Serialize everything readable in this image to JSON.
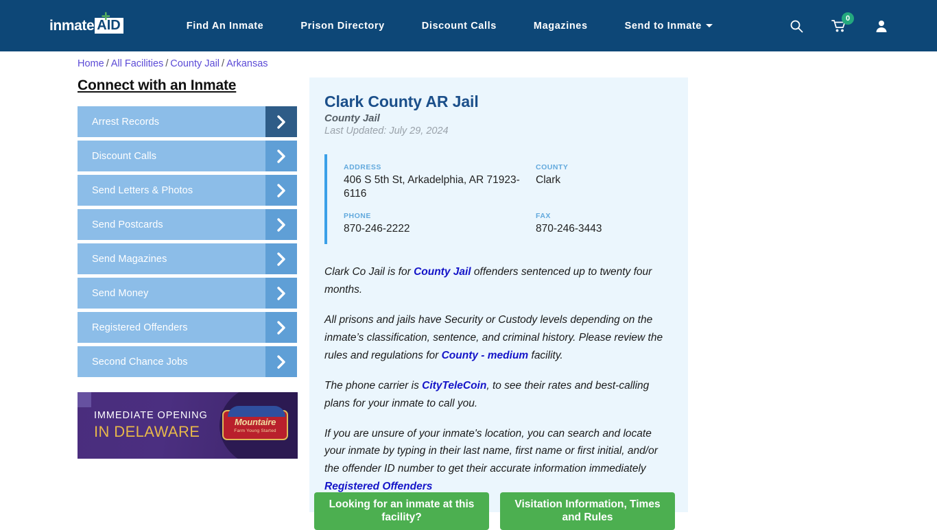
{
  "header": {
    "logo_word": "inmate",
    "logo_aid": "AID",
    "logo_plus": "✛",
    "nav": [
      {
        "label": "Find An Inmate",
        "has_caret": false
      },
      {
        "label": "Prison Directory",
        "has_caret": false
      },
      {
        "label": "Discount Calls",
        "has_caret": false
      },
      {
        "label": "Magazines",
        "has_caret": false
      },
      {
        "label": "Send to Inmate",
        "has_caret": true
      }
    ],
    "icons": {
      "search": "search-icon",
      "cart": "cart-icon",
      "cart_count": "0",
      "account": "user-icon"
    },
    "colors": {
      "background": "#0d4777",
      "badge": "#24a87e"
    }
  },
  "breadcrumb": {
    "items": [
      "Home",
      "All Facilities",
      "County Jail",
      "Arkansas"
    ],
    "separator": "/"
  },
  "sidebar": {
    "title": "Connect with an Inmate",
    "items": [
      {
        "label": "Arrest Records"
      },
      {
        "label": "Discount Calls"
      },
      {
        "label": "Send Letters & Photos"
      },
      {
        "label": "Send Postcards"
      },
      {
        "label": "Send Magazines"
      },
      {
        "label": "Send Money"
      },
      {
        "label": "Registered Offenders"
      },
      {
        "label": "Second Chance Jobs"
      }
    ]
  },
  "ad": {
    "line1": "IMMEDIATE OPENING",
    "line2": "IN DELAWARE",
    "brand": "Mountaire",
    "brand_sub": "Farm Young Started",
    "colors": {
      "background": "#4a2d7d",
      "accent": "#e7b74a"
    }
  },
  "facility": {
    "name": "Clark County AR Jail",
    "type": "County Jail",
    "last_updated": "Last Updated: July 29, 2024",
    "info": [
      {
        "label": "ADDRESS",
        "value": "406 S 5th St, Arkadelphia, AR 71923-6116"
      },
      {
        "label": "COUNTY",
        "value": "Clark"
      },
      {
        "label": "PHONE",
        "value": "870-246-2222"
      },
      {
        "label": "FAX",
        "value": "870-246-3443"
      }
    ],
    "paragraphs": [
      {
        "segments": [
          {
            "text": "Clark Co Jail is for ",
            "link": false
          },
          {
            "text": "County Jail",
            "link": true
          },
          {
            "text": " offenders sentenced up to twenty four months.",
            "link": false
          }
        ]
      },
      {
        "segments": [
          {
            "text": "All prisons and jails have Security or Custody levels depending on the inmate’s classification, sentence, and criminal history. Please review the rules and regulations for ",
            "link": false
          },
          {
            "text": "County - medium",
            "link": true
          },
          {
            "text": " facility.",
            "link": false
          }
        ]
      },
      {
        "segments": [
          {
            "text": "The phone carrier is ",
            "link": false
          },
          {
            "text": "CityTeleCoin",
            "link": true
          },
          {
            "text": ", to see their rates and best-calling plans for your inmate to call you.",
            "link": false
          }
        ]
      },
      {
        "segments": [
          {
            "text": "If you are unsure of your inmate's location, you can search and locate your inmate by typing in their last name, first name or first initial, and/or the offender ID number to get their accurate information immediately ",
            "link": false
          },
          {
            "text": "Registered Offenders",
            "link": true
          }
        ]
      }
    ]
  },
  "cta": {
    "buttons": [
      {
        "label": "Looking for an inmate at this facility?"
      },
      {
        "label": "Visitation Information, Times and Rules"
      }
    ],
    "color": "#4caf50"
  }
}
